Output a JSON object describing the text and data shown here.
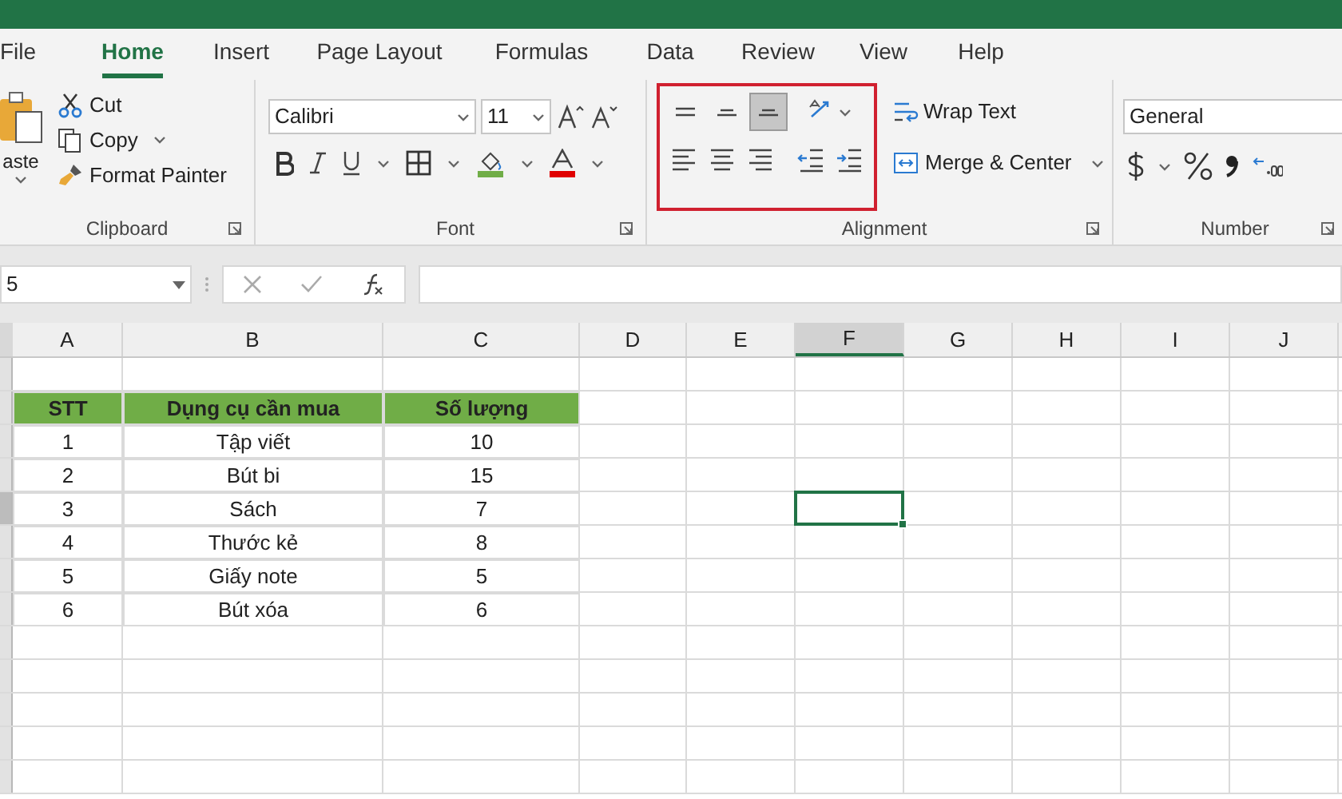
{
  "tabs": [
    {
      "label": "File",
      "selected": false
    },
    {
      "label": "Home",
      "selected": true
    },
    {
      "label": "Insert",
      "selected": false
    },
    {
      "label": "Page Layout",
      "selected": false
    },
    {
      "label": "Formulas",
      "selected": false
    },
    {
      "label": "Data",
      "selected": false
    },
    {
      "label": "Review",
      "selected": false
    },
    {
      "label": "View",
      "selected": false
    },
    {
      "label": "Help",
      "selected": false
    }
  ],
  "clipboard": {
    "paste": "aste",
    "cut": "Cut",
    "copy": "Copy",
    "format_painter": "Format Painter",
    "label": "Clipboard"
  },
  "font": {
    "name": "Calibri",
    "size": "11",
    "label": "Font"
  },
  "alignment": {
    "highlighted": true,
    "label": "Alignment",
    "wrap_text": "Wrap Text",
    "merge_center": "Merge & Center",
    "buttons": [
      {
        "kind": "top",
        "selected": false
      },
      {
        "kind": "middle",
        "selected": false
      },
      {
        "kind": "bottom",
        "selected": true
      },
      {
        "kind": "orientation",
        "selected": false
      },
      {
        "kind": "left",
        "selected": false
      },
      {
        "kind": "center",
        "selected": false
      },
      {
        "kind": "right",
        "selected": false
      },
      {
        "kind": "outdent",
        "selected": false
      },
      {
        "kind": "indent",
        "selected": false
      }
    ]
  },
  "number": {
    "format": "General",
    "label": "Number"
  },
  "formula_bar": {
    "name_box": "5"
  },
  "sheet": {
    "columns": [
      {
        "label": "A",
        "selected": false
      },
      {
        "label": "B",
        "selected": false
      },
      {
        "label": "C",
        "selected": false
      },
      {
        "label": "D",
        "selected": false
      },
      {
        "label": "E",
        "selected": false
      },
      {
        "label": "F",
        "selected": true
      },
      {
        "label": "G",
        "selected": false
      },
      {
        "label": "H",
        "selected": false
      },
      {
        "label": "I",
        "selected": false
      },
      {
        "label": "J",
        "selected": false
      }
    ],
    "rows": [
      {
        "kind": "empty",
        "active": false
      },
      {
        "kind": "header",
        "active": false,
        "cells": [
          "STT",
          "Dụng cụ cần mua",
          "Số lượng"
        ]
      },
      {
        "kind": "data",
        "active": false,
        "cells": [
          "1",
          "Tập viết",
          "10"
        ]
      },
      {
        "kind": "data",
        "active": false,
        "cells": [
          "2",
          "Bút bi",
          "15"
        ]
      },
      {
        "kind": "data",
        "active": true,
        "cells": [
          "3",
          "Sách",
          "7"
        ]
      },
      {
        "kind": "data",
        "active": false,
        "cells": [
          "4",
          "Thước kẻ",
          "8"
        ]
      },
      {
        "kind": "data",
        "active": false,
        "cells": [
          "5",
          "Giấy note",
          "5"
        ]
      },
      {
        "kind": "data",
        "active": false,
        "cells": [
          "6",
          "Bút xóa",
          "6"
        ]
      },
      {
        "kind": "empty",
        "active": false
      },
      {
        "kind": "empty",
        "active": false
      },
      {
        "kind": "empty",
        "active": false
      },
      {
        "kind": "empty",
        "active": false
      },
      {
        "kind": "empty",
        "active": false
      }
    ]
  }
}
